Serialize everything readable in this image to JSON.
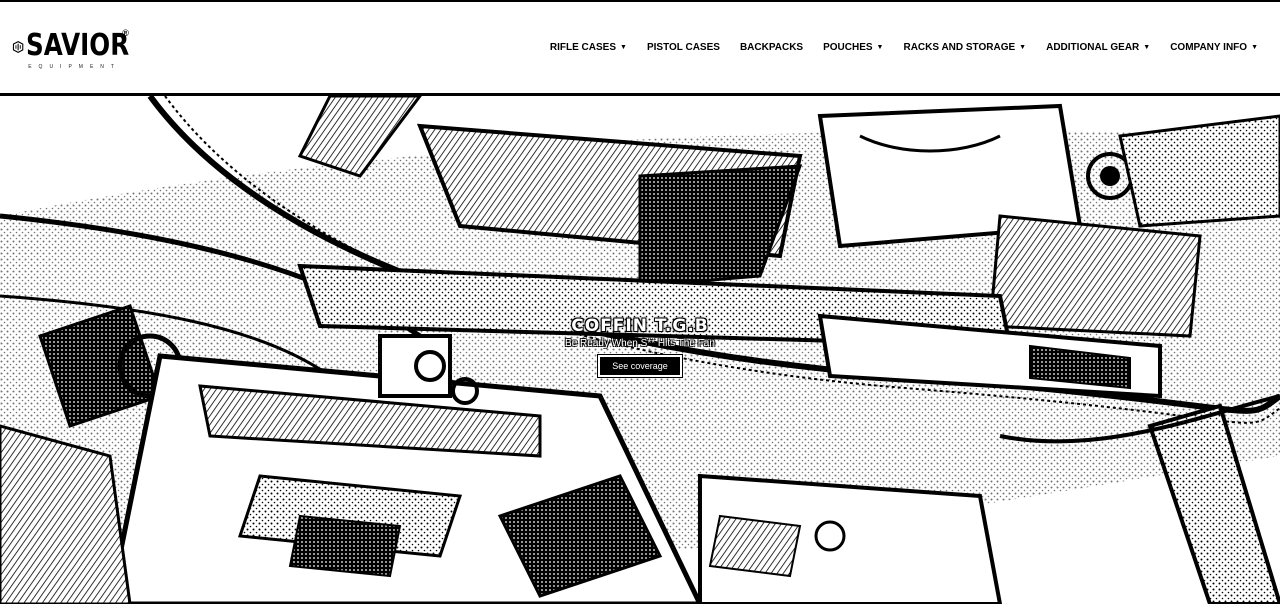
{
  "brand": {
    "name": "SAVIOR",
    "registered_mark": "®",
    "tagline": "EQUIPMENT",
    "logo_icon": "savior-shield-icon"
  },
  "nav": {
    "items": [
      {
        "label": "RIFLE CASES",
        "has_dropdown": true
      },
      {
        "label": "PISTOL CASES",
        "has_dropdown": false
      },
      {
        "label": "BACKPACKS",
        "has_dropdown": false
      },
      {
        "label": "POUCHES",
        "has_dropdown": true
      },
      {
        "label": "RACKS AND STORAGE",
        "has_dropdown": true
      },
      {
        "label": "ADDITIONAL GEAR",
        "has_dropdown": true
      },
      {
        "label": "COMPANY INFO",
        "has_dropdown": true
      }
    ],
    "caret_icon": "caret-down-icon",
    "caret_glyph": "▼"
  },
  "hero": {
    "title": "COFFIN T.G.B",
    "subtitle": "Be Ready When S** Hits The Fan",
    "button_label": "See coverage",
    "image_alt_icon": "rifle-case-photo",
    "colors": {
      "ink": "#000000",
      "paper": "#ffffff"
    }
  }
}
